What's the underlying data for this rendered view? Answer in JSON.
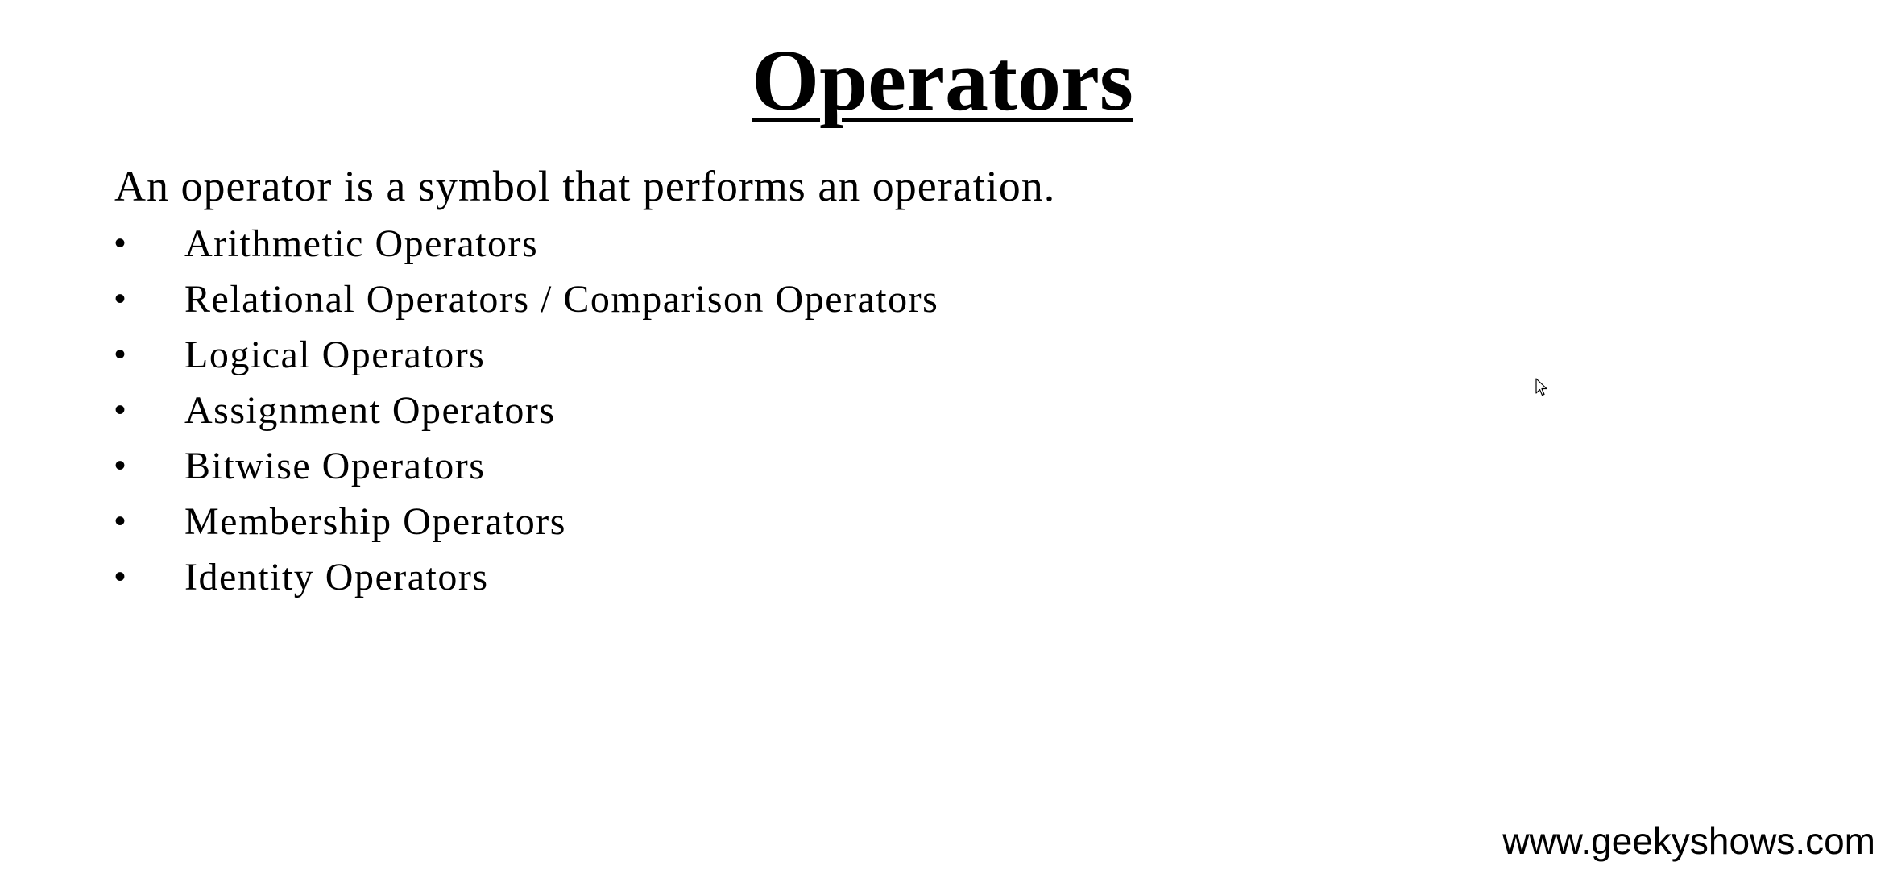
{
  "slide": {
    "title": "Operators",
    "intro": "An operator is a symbol that performs an operation.",
    "bullets": [
      "Arithmetic Operators",
      "Relational Operators / Comparison Operators",
      "Logical Operators",
      "Assignment Operators",
      "Bitwise Operators",
      "Membership Operators",
      "Identity Operators"
    ],
    "bullet_symbol": "•",
    "footer": "www.geekyshows.com"
  },
  "icons": {
    "cursor": "mouse-pointer-icon"
  }
}
